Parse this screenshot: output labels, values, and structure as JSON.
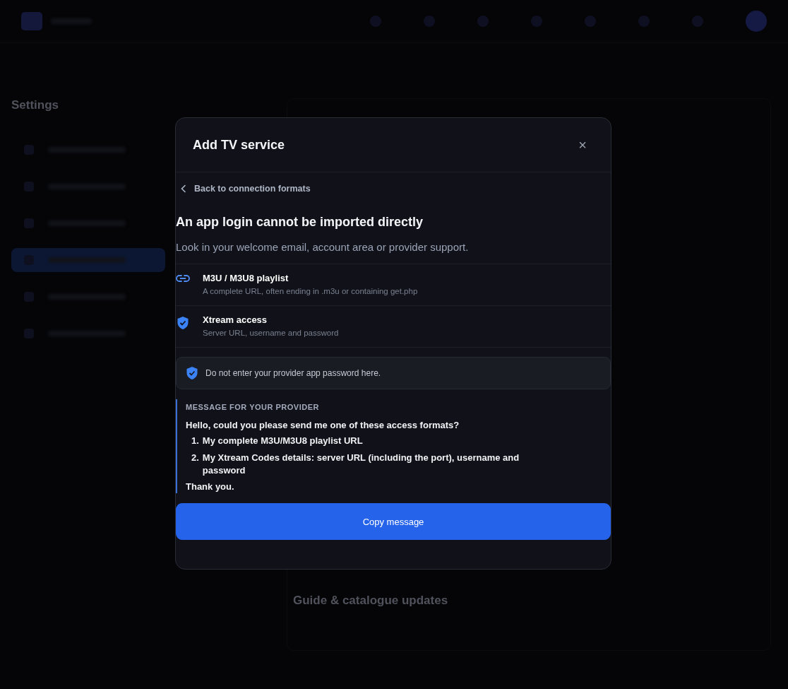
{
  "background": {
    "sidebar": {
      "title": "Settings",
      "items": [
        {
          "selected": false
        },
        {
          "selected": false
        },
        {
          "selected": false
        },
        {
          "selected": true
        },
        {
          "selected": false
        },
        {
          "selected": false
        }
      ]
    },
    "section_heading": "Guide & catalogue updates"
  },
  "modal": {
    "title": "Add TV service",
    "close": "×",
    "back_link": "Back to connection formats",
    "heading": "An app login cannot be imported directly",
    "subtitle": "Look in your welcome email, account area or provider support.",
    "options": [
      {
        "kind": "link",
        "title": "M3U / M3U8 playlist",
        "description": "A complete URL, often ending in .m3u or containing get.php"
      },
      {
        "kind": "shield",
        "title": "Xtream access",
        "description": "Server URL, username and password"
      }
    ],
    "notice": "Do not enter your provider app password here.",
    "message": {
      "label": "MESSAGE FOR YOUR PROVIDER",
      "greeting": "Hello, could you please send me one of these access formats?",
      "items": [
        {
          "number": "1.",
          "text": "My complete M3U/M3U8 playlist URL"
        },
        {
          "number": "2.",
          "text": "My Xtream Codes details: server URL (including the port), username and password"
        }
      ],
      "closing": "Thank you."
    },
    "button": "Copy message"
  }
}
